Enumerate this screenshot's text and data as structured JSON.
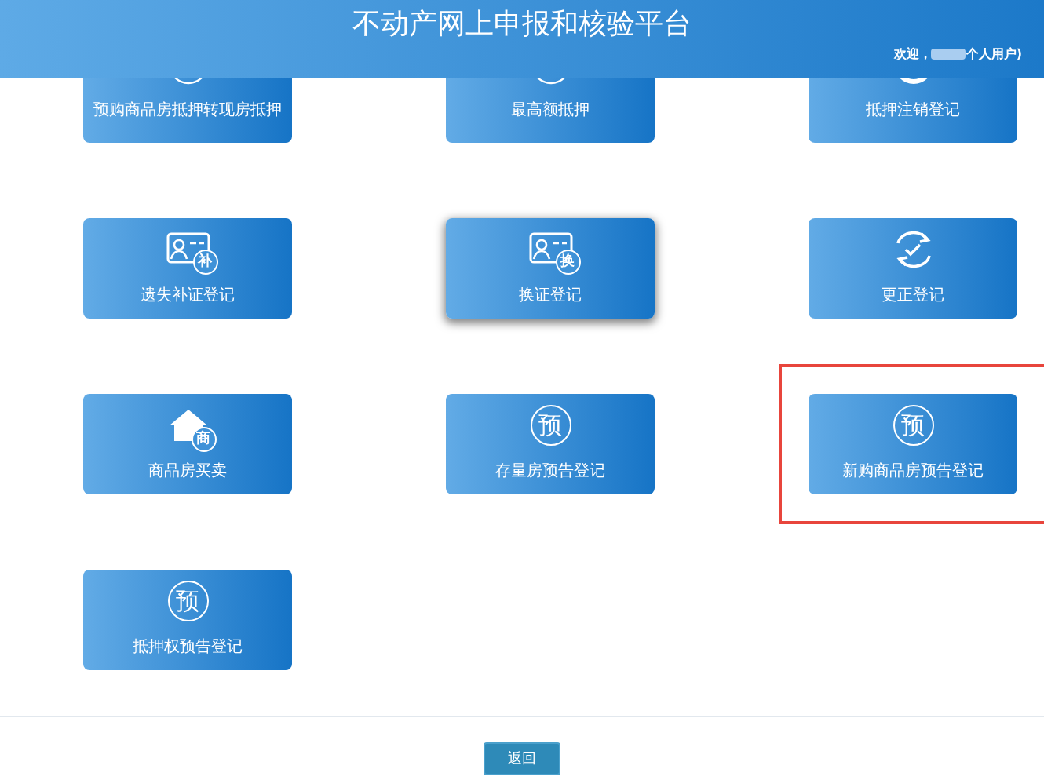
{
  "header": {
    "title": "不动产网上申报和核验平台",
    "welcome": {
      "prefix": "欢迎，",
      "suffix": "个人用户)"
    }
  },
  "tiles": [
    {
      "label": "预购商品房抵押转现房抵押",
      "icon": {
        "kind": "ring"
      },
      "hovered": false,
      "highlighted": false,
      "cut_off_top": true
    },
    {
      "label": "最高额抵押",
      "icon": {
        "kind": "ring"
      },
      "hovered": false,
      "highlighted": false,
      "cut_off_top": true
    },
    {
      "label": "抵押注销登记",
      "icon": {
        "kind": "ring-thick"
      },
      "hovered": false,
      "highlighted": false,
      "cut_off_top": true
    },
    {
      "label": "遗失补证登记",
      "icon": {
        "kind": "id-card",
        "char": "补"
      },
      "hovered": false,
      "highlighted": false
    },
    {
      "label": "换证登记",
      "icon": {
        "kind": "id-card",
        "char": "换"
      },
      "hovered": true,
      "highlighted": false
    },
    {
      "label": "更正登记",
      "icon": {
        "kind": "refresh"
      },
      "hovered": false,
      "highlighted": false
    },
    {
      "label": "商品房买卖",
      "icon": {
        "kind": "house",
        "char": "商"
      },
      "hovered": false,
      "highlighted": false
    },
    {
      "label": "存量房预告登记",
      "icon": {
        "kind": "circle-char",
        "char": "预"
      },
      "hovered": false,
      "highlighted": false
    },
    {
      "label": "新购商品房预告登记",
      "icon": {
        "kind": "circle-char",
        "char": "预"
      },
      "hovered": false,
      "highlighted": true
    },
    {
      "label": "抵押权预告登记",
      "icon": {
        "kind": "circle-char",
        "char": "预"
      },
      "hovered": false,
      "highlighted": false
    }
  ],
  "back_button": "返回"
}
